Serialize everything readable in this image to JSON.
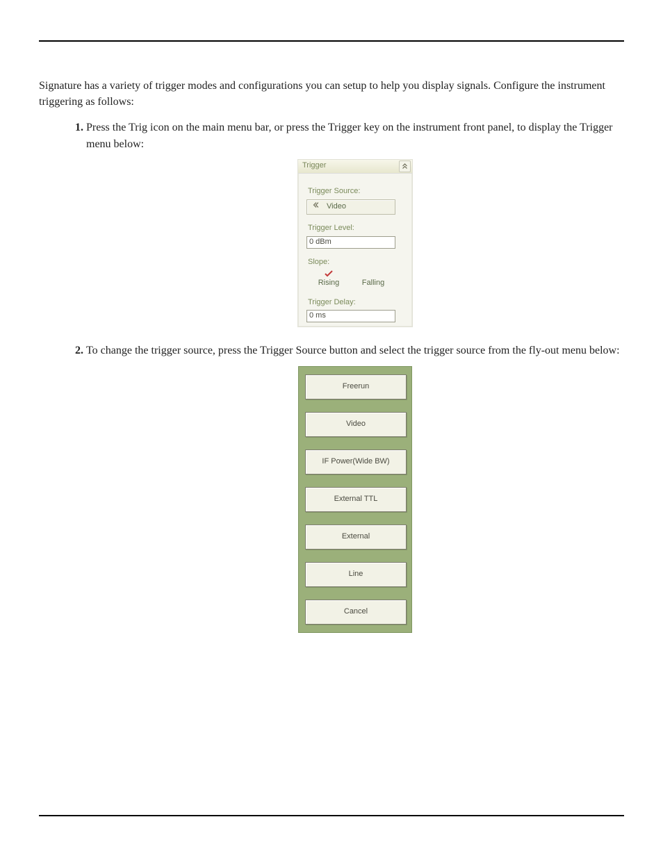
{
  "intro": {
    "p1": "Signature has a variety of trigger modes and configurations you can setup to help you display signals. Configure the instrument triggering as follows:"
  },
  "steps": {
    "s1": "Press the Trig icon on the main menu bar, or press the Trigger key on the instrument front panel, to display the Trigger menu below:",
    "s2": "To change the trigger source, press the Trigger Source button and select the trigger source from the fly-out menu below:"
  },
  "trigger_panel": {
    "title": "Trigger",
    "collapse_icon": "collapse-up-icon",
    "source_label": "Trigger Source:",
    "source_value": "Video",
    "level_label": "Trigger Level:",
    "level_value": "0 dBm",
    "slope_label": "Slope:",
    "slope_rising": "Rising",
    "slope_falling": "Falling",
    "slope_selected": "rising",
    "delay_label": "Trigger Delay:",
    "delay_value": "0 ms"
  },
  "flyout": {
    "options": [
      "Freerun",
      "Video",
      "IF Power(Wide BW)",
      "External TTL",
      "External",
      "Line",
      "Cancel"
    ]
  }
}
